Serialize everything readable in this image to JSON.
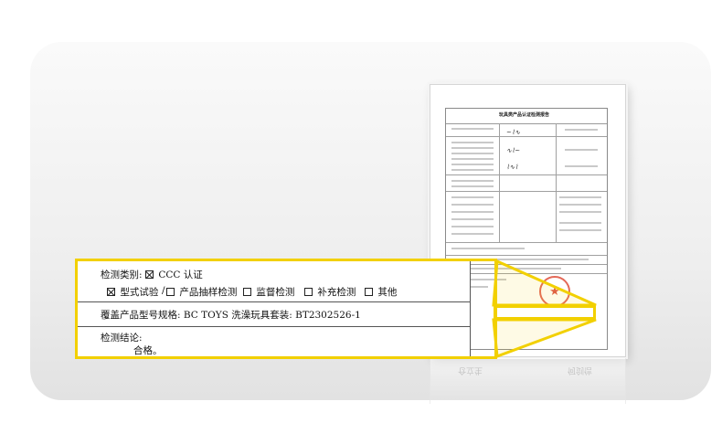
{
  "colors": {
    "highlight_frame": "#f2d000",
    "seal_red": "#d83a2a",
    "panel_bg": "#eeeeee"
  },
  "zoom": {
    "inspection_category_label": "检测类别:",
    "ccc_label": "CCC 认证",
    "ccc_checked": true,
    "options": [
      {
        "label": "型式试验",
        "checked": true
      },
      {
        "label": "产品抽样检测",
        "checked": false
      },
      {
        "label": "监督检测",
        "checked": false
      },
      {
        "label": "补充检测",
        "checked": false
      },
      {
        "label": "其他",
        "checked": false
      }
    ],
    "slash": "/",
    "models_covered": "覆盖产品型号规格: BC TOYS 洗澡玩具套装: BT2302526-1",
    "conclusion_label": "检测结论:",
    "conclusion_value": "合格。"
  },
  "certificate": {
    "title": "玩具类产品认证检测报告",
    "reflection_left": "仓立生",
    "reflection_right": "何剑信"
  }
}
